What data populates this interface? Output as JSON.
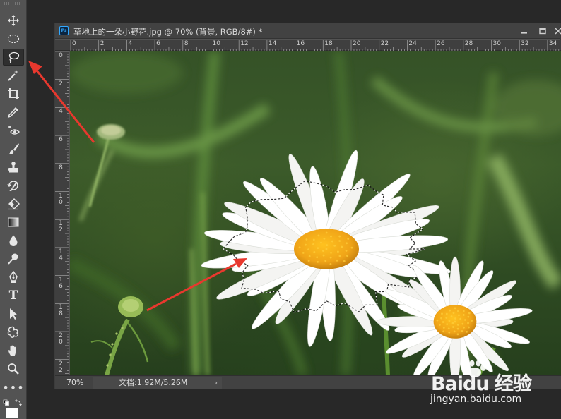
{
  "toolbar": {
    "tools": [
      {
        "name": "move-tool",
        "icon": "move-icon"
      },
      {
        "name": "elliptical-marquee-tool",
        "icon": "ellipse-marquee-icon"
      },
      {
        "name": "lasso-tool",
        "icon": "lasso-icon",
        "active": true
      },
      {
        "name": "magic-wand-tool",
        "icon": "magic-wand-icon"
      },
      {
        "name": "crop-tool",
        "icon": "crop-icon"
      },
      {
        "name": "eyedropper-tool",
        "icon": "eyedropper-icon"
      },
      {
        "name": "red-eye-tool",
        "icon": "red-eye-icon"
      },
      {
        "name": "brush-tool",
        "icon": "brush-icon"
      },
      {
        "name": "clone-stamp-tool",
        "icon": "stamp-icon"
      },
      {
        "name": "history-brush-tool",
        "icon": "history-brush-icon"
      },
      {
        "name": "eraser-tool",
        "icon": "eraser-icon"
      },
      {
        "name": "gradient-tool",
        "icon": "gradient-icon"
      },
      {
        "name": "blur-tool",
        "icon": "blur-drop-icon"
      },
      {
        "name": "dodge-tool",
        "icon": "dodge-icon"
      },
      {
        "name": "pen-tool",
        "icon": "pen-icon"
      },
      {
        "name": "type-tool",
        "icon": "type-icon",
        "label": "T"
      },
      {
        "name": "path-selection-tool",
        "icon": "arrow-select-icon"
      },
      {
        "name": "custom-shape-tool",
        "icon": "shape-icon"
      },
      {
        "name": "hand-tool",
        "icon": "hand-icon"
      },
      {
        "name": "zoom-tool",
        "icon": "zoom-icon"
      },
      {
        "name": "edit-toolbar",
        "icon": "more-icon",
        "label": "•••"
      }
    ]
  },
  "document": {
    "title": "草地上的一朵小野花.jpg @ 70% (背景, RGB/8#) *",
    "ruler_top_labels": [
      "0",
      "2",
      "4",
      "6",
      "8",
      "10",
      "12",
      "14",
      "16",
      "18",
      "20",
      "22",
      "24",
      "26",
      "28",
      "30",
      "32",
      "34"
    ],
    "ruler_left_labels": [
      "0",
      "2",
      "4",
      "6",
      "8",
      "1\n0",
      "1\n2",
      "1\n4",
      "1\n6",
      "1\n8",
      "2\n0",
      "2\n2"
    ],
    "zoom": "70%",
    "doc_info": "文档:1.92M/5.26M"
  },
  "watermark": {
    "logo_text": "Baidu 经验",
    "url": "jingyan.baidu.com"
  },
  "colors": {
    "accent_arrow": "#e8382e",
    "selection": "#ffffff",
    "ps_blue": "#31a8ff"
  }
}
